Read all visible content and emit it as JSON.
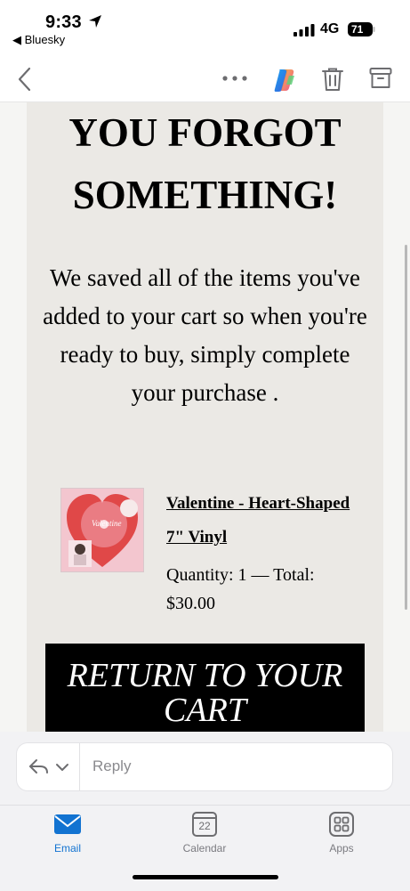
{
  "status_bar": {
    "time": "9:33",
    "back_app": "◀ Bluesky",
    "network": "4G",
    "battery": "71"
  },
  "toolbar": {
    "icons": [
      "back-chevron-icon",
      "more-icon",
      "copilot-icon",
      "trash-icon",
      "archive-icon"
    ]
  },
  "email": {
    "headline": "YOU FORGOT SOMETHING!",
    "body": "We saved all of the items you've added to your cart so when you're ready to buy, simply complete your purchase .",
    "product": {
      "title": "Valentine - Heart-Shaped 7\" Vinyl",
      "quantity_total": "Quantity: 1 — Total: $30.00",
      "image_text": "Valentine"
    },
    "cta": "RETURN TO YOUR CART"
  },
  "reply": {
    "placeholder": "Reply"
  },
  "tabs": [
    {
      "label": "Email",
      "active": true
    },
    {
      "label": "Calendar",
      "active": false,
      "date": "22"
    },
    {
      "label": "Apps",
      "active": false
    }
  ],
  "colors": {
    "accent": "#1273d1",
    "card_bg": "#ebe9e5",
    "cta_bg": "#000000"
  }
}
